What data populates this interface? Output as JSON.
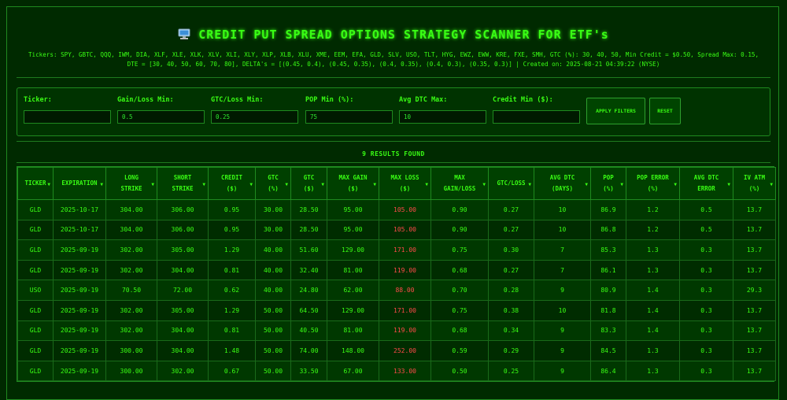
{
  "header": {
    "icon": "computer-monitor-icon",
    "title": "CREDIT PUT SPREAD OPTIONS STRATEGY SCANNER FOR ETF's",
    "info_line1": "Tickers: SPY, GBTC, QQQ, IWM, DIA, XLF, XLE, XLK, XLV, XLI, XLY, XLP, XLB, XLU, XME, EEM, EFA, GLD, SLV, USO, TLT, HYG, EWZ, EWW, KRE, FXE, SMH, GTC (%): 30, 40, 50, Min Credit = $0.50, Spread Max: 0.15,",
    "info_line2": "DTE = [30, 40, 50, 60, 70, 80], DELTA's = [(0.45, 0.4), (0.45, 0.35), (0.4, 0.35), (0.4, 0.3), (0.35, 0.3)] | Created on: 2025-08-21 04:39:22 (NYSE)"
  },
  "filters": {
    "ticker": {
      "label": "Ticker:",
      "value": ""
    },
    "gain_loss_min": {
      "label": "Gain/Loss Min:",
      "value": "0.5"
    },
    "gtc_loss_min": {
      "label": "GTC/Loss Min:",
      "value": "0.25"
    },
    "pop_min": {
      "label": "POP Min (%):",
      "value": "75"
    },
    "avg_dtc_max": {
      "label": "Avg DTC Max:",
      "value": "10"
    },
    "credit_min": {
      "label": "Credit Min ($):",
      "value": ""
    },
    "apply_label": "APPLY FILTERS",
    "reset_label": "RESET"
  },
  "results_label": "9 RESULTS FOUND",
  "table": {
    "columns": [
      [
        "TICKER"
      ],
      [
        "EXPIRATION"
      ],
      [
        "LONG",
        "STRIKE"
      ],
      [
        "SHORT",
        "STRIKE"
      ],
      [
        "CREDIT",
        "($)"
      ],
      [
        "GTC",
        "(%)"
      ],
      [
        "GTC",
        "($)"
      ],
      [
        "MAX GAIN",
        "($)"
      ],
      [
        "MAX LOSS",
        "($)"
      ],
      [
        "MAX",
        "GAIN/LOSS"
      ],
      [
        "GTC/LOSS"
      ],
      [
        "AVG DTC",
        "(DAYS)"
      ],
      [
        "POP",
        "(%)"
      ],
      [
        "POP ERROR",
        "(%)"
      ],
      [
        "AVG DTC",
        "ERROR"
      ],
      [
        "IV ATM",
        "(%)"
      ]
    ],
    "rows": [
      [
        "GLD",
        "2025-10-17",
        "304.00",
        "306.00",
        "0.95",
        "30.00",
        "28.50",
        "95.00",
        "105.00",
        "0.90",
        "0.27",
        "10",
        "86.9",
        "1.2",
        "0.5",
        "13.7"
      ],
      [
        "GLD",
        "2025-10-17",
        "304.00",
        "306.00",
        "0.95",
        "30.00",
        "28.50",
        "95.00",
        "105.00",
        "0.90",
        "0.27",
        "10",
        "86.8",
        "1.2",
        "0.5",
        "13.7"
      ],
      [
        "GLD",
        "2025-09-19",
        "302.00",
        "305.00",
        "1.29",
        "40.00",
        "51.60",
        "129.00",
        "171.00",
        "0.75",
        "0.30",
        "7",
        "85.3",
        "1.3",
        "0.3",
        "13.7"
      ],
      [
        "GLD",
        "2025-09-19",
        "302.00",
        "304.00",
        "0.81",
        "40.00",
        "32.40",
        "81.00",
        "119.00",
        "0.68",
        "0.27",
        "7",
        "86.1",
        "1.3",
        "0.3",
        "13.7"
      ],
      [
        "USO",
        "2025-09-19",
        "70.50",
        "72.00",
        "0.62",
        "40.00",
        "24.80",
        "62.00",
        "88.00",
        "0.70",
        "0.28",
        "9",
        "80.9",
        "1.4",
        "0.3",
        "29.3"
      ],
      [
        "GLD",
        "2025-09-19",
        "302.00",
        "305.00",
        "1.29",
        "50.00",
        "64.50",
        "129.00",
        "171.00",
        "0.75",
        "0.38",
        "10",
        "81.8",
        "1.4",
        "0.3",
        "13.7"
      ],
      [
        "GLD",
        "2025-09-19",
        "302.00",
        "304.00",
        "0.81",
        "50.00",
        "40.50",
        "81.00",
        "119.00",
        "0.68",
        "0.34",
        "9",
        "83.3",
        "1.4",
        "0.3",
        "13.7"
      ],
      [
        "GLD",
        "2025-09-19",
        "300.00",
        "304.00",
        "1.48",
        "50.00",
        "74.00",
        "148.00",
        "252.00",
        "0.59",
        "0.29",
        "9",
        "84.5",
        "1.3",
        "0.3",
        "13.7"
      ],
      [
        "GLD",
        "2025-09-19",
        "300.00",
        "302.00",
        "0.67",
        "50.00",
        "33.50",
        "67.00",
        "133.00",
        "0.50",
        "0.25",
        "9",
        "86.4",
        "1.3",
        "0.3",
        "13.7"
      ]
    ]
  },
  "colors": {
    "accent": "#39ff14",
    "loss": "#ff4a4a",
    "background": "#002800"
  }
}
